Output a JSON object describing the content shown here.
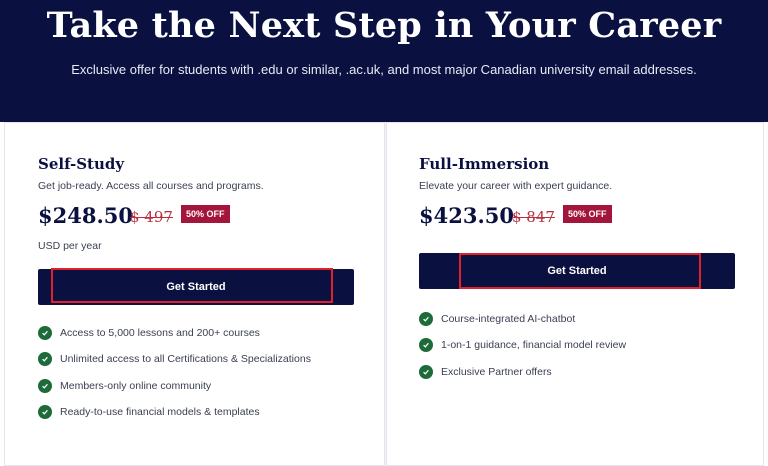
{
  "hero": {
    "title": "Take the Next Step in Your Career",
    "subtitle": "Exclusive offer for students with .edu or similar, .ac.uk, and most major Canadian university email addresses."
  },
  "plans": [
    {
      "name": "Self-Study",
      "description": "Get job-ready. Access all courses and programs.",
      "price": "$248.50",
      "old_price": "$ 497",
      "badge": "50% OFF",
      "period": "USD per year",
      "cta_label": "Get Started",
      "features": [
        "Access to 5,000 lessons and 200+ courses",
        "Unlimited access to all Certifications & Specializations",
        "Members-only online community",
        "Ready-to-use financial models & templates"
      ]
    },
    {
      "name": "Full-Immersion",
      "description": "Elevate your career with expert guidance.",
      "price": "$423.50",
      "old_price": "$ 847",
      "badge": "50% OFF",
      "cta_label": "Get Started",
      "features": [
        "Course-integrated AI-chatbot",
        "1-on-1 guidance, financial model review",
        "Exclusive Partner offers"
      ]
    }
  ],
  "colors": {
    "navy": "#0a1140",
    "badge": "#a3153a",
    "check": "#1e6b3a",
    "highlight": "#e0202a"
  }
}
